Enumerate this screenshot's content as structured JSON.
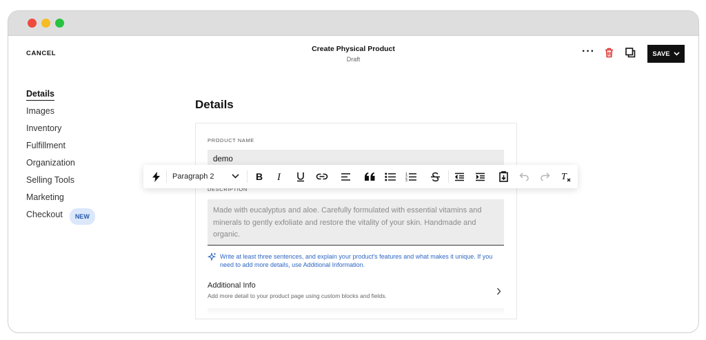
{
  "topbar": {
    "cancel": "CANCEL",
    "title": "Create Physical Product",
    "subtitle": "Draft",
    "more": "···",
    "save": "SAVE"
  },
  "sidebar": {
    "items": [
      {
        "label": "Details",
        "active": true
      },
      {
        "label": "Images"
      },
      {
        "label": "Inventory"
      },
      {
        "label": "Fulfillment"
      },
      {
        "label": "Organization"
      },
      {
        "label": "Selling Tools"
      },
      {
        "label": "Marketing"
      },
      {
        "label": "Checkout",
        "badge": "NEW"
      }
    ]
  },
  "main": {
    "heading": "Details",
    "product_name_label": "PRODUCT NAME",
    "product_name_value": "demo",
    "description_label": "DESCRIPTION",
    "description_value": "Made with eucalyptus and aloe. Carefully formulated with essential vitamins and minerals to gently exfoliate and restore the vitality of your skin. Handmade and organic.",
    "hint": "Write at least three sentences, and explain your product's features and what makes it unique. If you need to add more details, use Additional Information.",
    "additional_title": "Additional Info",
    "additional_subtitle": "Add more detail to your product page using custom blocks and fields."
  },
  "toolbar": {
    "paragraph_style": "Paragraph 2",
    "tools": [
      "lightning-icon",
      "bold-icon",
      "italic-icon",
      "underline-icon",
      "link-icon",
      "align-left-icon",
      "blockquote-icon",
      "bullet-list-icon",
      "numbered-list-icon",
      "strikethrough-icon",
      "outdent-icon",
      "indent-icon",
      "paste-icon",
      "undo-icon",
      "redo-icon",
      "clear-format-icon"
    ]
  },
  "colors": {
    "accent_blue": "#2d66c2",
    "badge_bg": "#dbe8fb",
    "delete_red": "#d9302c",
    "save_bg": "#111111"
  }
}
